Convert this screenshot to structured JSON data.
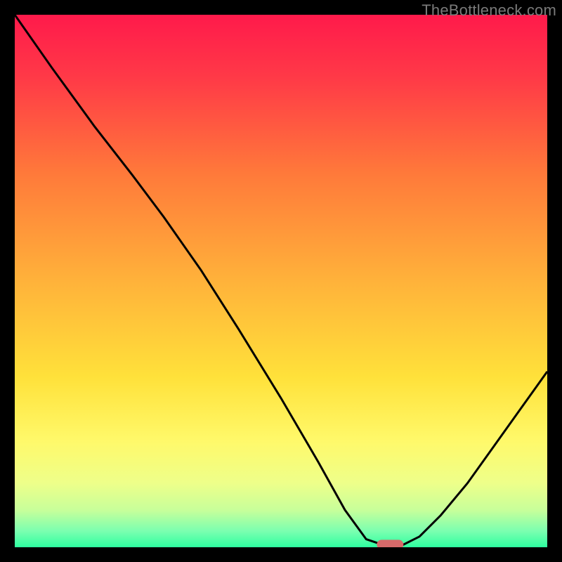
{
  "watermark": "TheBottleneck.com",
  "chart_data": {
    "type": "line",
    "title": "",
    "xlabel": "",
    "ylabel": "",
    "xlim": [
      0,
      100
    ],
    "ylim": [
      0,
      100
    ],
    "grid": false,
    "legend": false,
    "background": {
      "type": "vertical-gradient",
      "stops": [
        {
          "pos": 0.0,
          "color": "#ff1a4b"
        },
        {
          "pos": 0.12,
          "color": "#ff3a47"
        },
        {
          "pos": 0.3,
          "color": "#ff7a3a"
        },
        {
          "pos": 0.5,
          "color": "#ffb23a"
        },
        {
          "pos": 0.68,
          "color": "#ffe13a"
        },
        {
          "pos": 0.8,
          "color": "#fff96a"
        },
        {
          "pos": 0.88,
          "color": "#eeff8a"
        },
        {
          "pos": 0.93,
          "color": "#c8ff9a"
        },
        {
          "pos": 0.97,
          "color": "#7affb0"
        },
        {
          "pos": 1.0,
          "color": "#2effa0"
        }
      ]
    },
    "series": [
      {
        "name": "bottleneck-curve",
        "color": "#000000",
        "values": [
          {
            "x": 0,
            "y": 100
          },
          {
            "x": 7,
            "y": 90
          },
          {
            "x": 15,
            "y": 79
          },
          {
            "x": 22,
            "y": 70
          },
          {
            "x": 28,
            "y": 62
          },
          {
            "x": 35,
            "y": 52
          },
          {
            "x": 42,
            "y": 41
          },
          {
            "x": 50,
            "y": 28
          },
          {
            "x": 57,
            "y": 16
          },
          {
            "x": 62,
            "y": 7
          },
          {
            "x": 66,
            "y": 1.5
          },
          {
            "x": 69,
            "y": 0.5
          },
          {
            "x": 73,
            "y": 0.5
          },
          {
            "x": 76,
            "y": 2
          },
          {
            "x": 80,
            "y": 6
          },
          {
            "x": 85,
            "y": 12
          },
          {
            "x": 90,
            "y": 19
          },
          {
            "x": 95,
            "y": 26
          },
          {
            "x": 100,
            "y": 33
          }
        ]
      }
    ],
    "marker": {
      "name": "optimal-point",
      "shape": "pill",
      "x": 70.5,
      "y": 0.5,
      "width": 5,
      "height": 1.8,
      "color": "#d66a6a"
    }
  }
}
